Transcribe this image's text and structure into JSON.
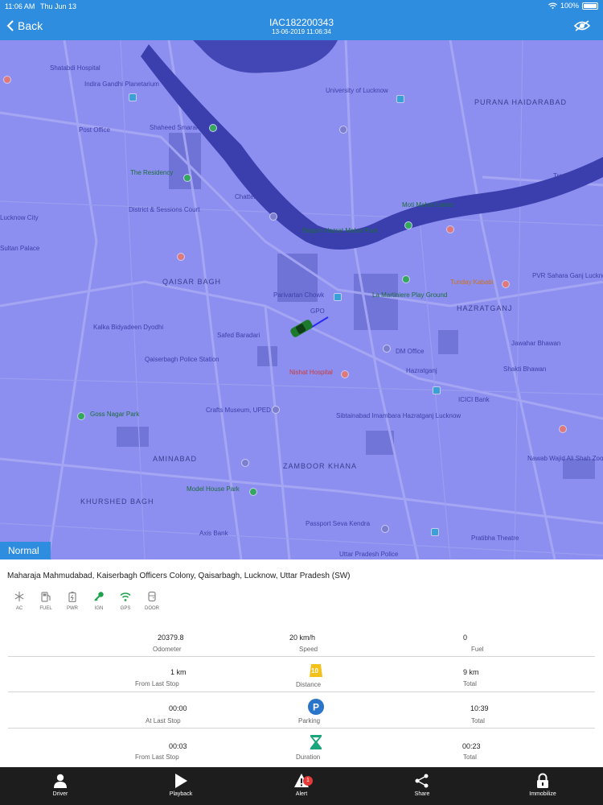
{
  "status_bar": {
    "time": "11:06 AM",
    "date": "Thu Jun 13",
    "battery": "100%"
  },
  "header": {
    "back_label": "Back",
    "title": "IAC182200343",
    "subtitle": "13-06-2019 11:06:34"
  },
  "map": {
    "mode_label": "Normal",
    "areas": [
      "PURANA HAIDARABAD",
      "QAISAR BAGH",
      "HAZRATGANJ",
      "AMINABAD",
      "ZAMBOOR KHANA",
      "KHURSHED BAGH"
    ],
    "places": [
      "Shatabdi Hospital",
      "Indira Gandhi Planetarium",
      "University of Lucknow",
      "Post Office",
      "Shaheed Smarak",
      "The Residency",
      "Chatter Manzil",
      "Moti Mahal Lawns",
      "Transport",
      "District & Sessions Court",
      "Begum Hazrat Mahal Park",
      "Parivartan Chowk",
      "La Martiniere Play Ground",
      "Tunday Kababi",
      "PVR Sahara Ganj Lucknow",
      "Kalka Bidyadeen Dyodhi",
      "Safed Baradari",
      "GPO",
      "DM Office",
      "Qaiserbagh Police Station",
      "Nishat Hospital",
      "Jawahar Bhawan",
      "Shakti Bhawan",
      "Hazratganj",
      "Goss Nagar Park",
      "Crafts Museum, UPED",
      "ICICI Bank",
      "Sibtainabad Imambara Hazratganj Lucknow",
      "Nawab Wajid Ali Shah Zoological Garden",
      "Model House Park",
      "Passport Seva Kendra",
      "Pratibha Theatre",
      "Axis Bank",
      "Uttar Pradesh Police",
      "Sultan Palace",
      "Lucknow City"
    ]
  },
  "address": "Maharaja Mahmudabad, Kaiserbagh Officers Colony, Qaisarbagh, Lucknow, Uttar Pradesh (SW)",
  "sensors": [
    {
      "label": "AC",
      "icon": "snowflake-icon",
      "active": false
    },
    {
      "label": "FUEL",
      "icon": "fuel-icon",
      "active": false
    },
    {
      "label": "PWR",
      "icon": "battery-icon",
      "active": false
    },
    {
      "label": "IGN",
      "icon": "key-icon",
      "active": true
    },
    {
      "label": "GPS",
      "icon": "wifi-icon",
      "active": true
    },
    {
      "label": "DOOR",
      "icon": "door-icon",
      "active": false
    }
  ],
  "stats": {
    "odometer": {
      "value": "20379.8",
      "label": "Odometer"
    },
    "speed": {
      "value": "20 km/h",
      "label": "Speed"
    },
    "fuel": {
      "value": "0",
      "label": "Fuel"
    },
    "distance": {
      "from_last_stop": "1 km",
      "from_last_stop_label": "From Last Stop",
      "icon_value": "10",
      "label": "Distance",
      "total": "9 km",
      "total_label": "Total"
    },
    "parking": {
      "at_last_stop": "00:00",
      "at_last_stop_label": "At Last Stop",
      "label": "Parking",
      "total": "10:39",
      "total_label": "Total"
    },
    "duration": {
      "from_last_stop": "00:03",
      "from_last_stop_label": "From Last Stop",
      "label": "Duration",
      "total": "00:23",
      "total_label": "Total"
    }
  },
  "tabs": [
    {
      "label": "Driver",
      "icon": "person-icon"
    },
    {
      "label": "Playback",
      "icon": "play-icon"
    },
    {
      "label": "Alert",
      "icon": "warning-icon",
      "badge": "1"
    },
    {
      "label": "Share",
      "icon": "share-icon"
    },
    {
      "label": "Immobilize",
      "icon": "lock-icon"
    }
  ],
  "colors": {
    "accent": "#2f8de0",
    "map_fill": "#8d8ff0",
    "river": "#3b3fae",
    "active_sensor": "#1aa34a",
    "tab_bar": "#1d1d1d"
  }
}
